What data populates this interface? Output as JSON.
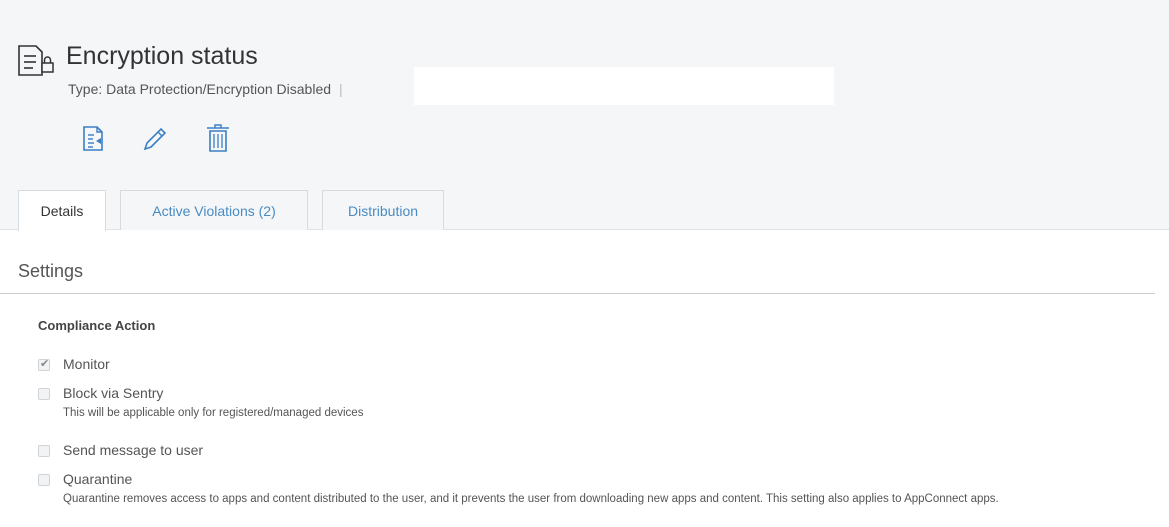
{
  "header": {
    "title": "Encryption status",
    "type_line": "Type: Data Protection/Encryption Disabled",
    "type_separator": "|",
    "title_icon": "policy-lock-icon",
    "actions": [
      {
        "icon": "export-document-icon"
      },
      {
        "icon": "pencil-edit-icon"
      },
      {
        "icon": "trash-icon"
      }
    ]
  },
  "tabs": [
    {
      "label": "Details",
      "active": true
    },
    {
      "label": "Active Violations (2)",
      "active": false
    },
    {
      "label": "Distribution",
      "active": false
    }
  ],
  "settings": {
    "title": "Settings",
    "section": "Compliance Action",
    "options": [
      {
        "label": "Monitor",
        "checked": true,
        "desc": ""
      },
      {
        "label": "Block via Sentry",
        "checked": false,
        "desc": "This will be applicable only for registered/managed devices"
      },
      {
        "label": "Send message to user",
        "checked": false,
        "desc": ""
      },
      {
        "label": "Quarantine",
        "checked": false,
        "desc": "Quarantine removes access to apps and content distributed to the user, and it prevents the user from downloading new apps and content. This setting also applies to AppConnect apps."
      }
    ]
  },
  "colors": {
    "header_bg": "#f4f6f8",
    "tab_link": "#4a8bc2",
    "icon_blue": "#3b7fc4"
  }
}
